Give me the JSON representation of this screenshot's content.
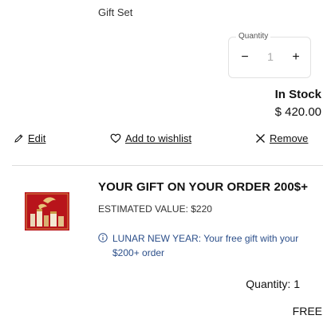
{
  "item": {
    "subtitle": "Gift Set",
    "quantity_label": "Quantity",
    "quantity_value": "1",
    "minus_glyph": "−",
    "plus_glyph": "+",
    "stock_status": "In Stock",
    "price": "$ 420.00"
  },
  "actions": {
    "edit": "Edit",
    "add_to_wishlist": "Add to wishlist",
    "remove": "Remove"
  },
  "gift": {
    "title": "YOUR GIFT ON YOUR ORDER 200$+",
    "estimated_value": "ESTIMATED VALUE: $220",
    "promo_text": "LUNAR NEW YEAR: Your free gift with your $200+ order",
    "quantity": "Quantity: 1",
    "price": "FREE",
    "promo_color": "#2c4f8a",
    "image_color": "#b8141b"
  },
  "icons": {
    "edit": "pencil-icon",
    "wishlist": "heart-icon",
    "remove": "close-icon",
    "promo": "info-icon"
  }
}
